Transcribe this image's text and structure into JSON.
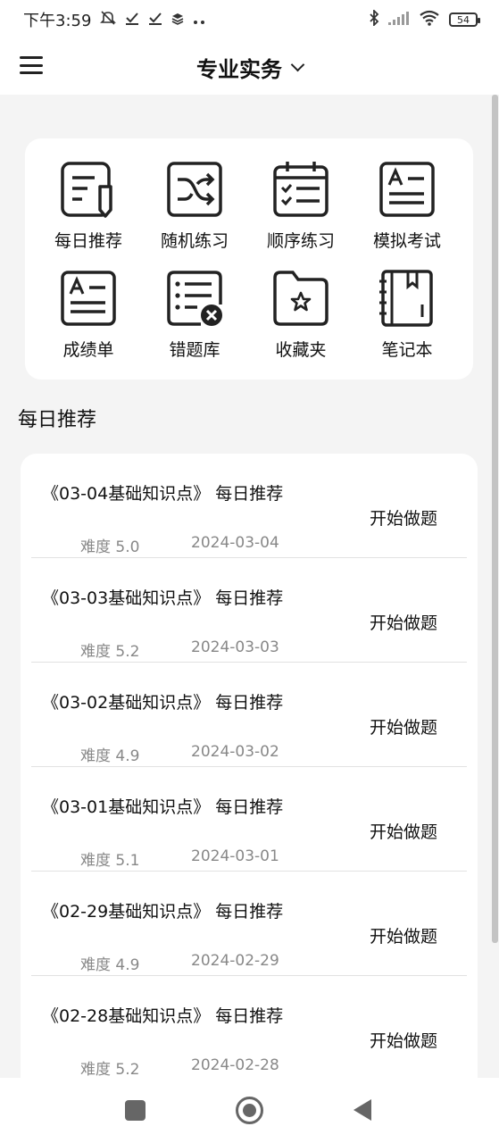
{
  "status_bar": {
    "time": "下午3:59",
    "battery": "54",
    "left_icons": [
      "mute-icon",
      "check-icon",
      "check-icon",
      "layers-icon",
      "more-dots-icon"
    ],
    "right_icons": [
      "bluetooth-icon",
      "signal-icon",
      "wifi-icon",
      "battery-icon"
    ]
  },
  "header": {
    "title": "专业实务"
  },
  "grid": {
    "items": [
      {
        "label": "每日推荐",
        "icon": "daily-recommend-icon"
      },
      {
        "label": "随机练习",
        "icon": "shuffle-icon"
      },
      {
        "label": "顺序练习",
        "icon": "calendar-list-icon"
      },
      {
        "label": "模拟考试",
        "icon": "exam-paper-icon"
      },
      {
        "label": "成绩单",
        "icon": "transcript-icon"
      },
      {
        "label": "错题库",
        "icon": "wrong-list-icon"
      },
      {
        "label": "收藏夹",
        "icon": "favorite-folder-icon"
      },
      {
        "label": "笔记本",
        "icon": "notebook-icon"
      }
    ]
  },
  "section": {
    "title": "每日推荐"
  },
  "list": {
    "rows": [
      {
        "title": "《03-04基础知识点》 每日推荐",
        "difficulty": "难度 5.0",
        "date": "2024-03-04",
        "action": "开始做题"
      },
      {
        "title": "《03-03基础知识点》 每日推荐",
        "difficulty": "难度 5.2",
        "date": "2024-03-03",
        "action": "开始做题"
      },
      {
        "title": "《03-02基础知识点》 每日推荐",
        "difficulty": "难度 4.9",
        "date": "2024-03-02",
        "action": "开始做题"
      },
      {
        "title": "《03-01基础知识点》 每日推荐",
        "difficulty": "难度 5.1",
        "date": "2024-03-01",
        "action": "开始做题"
      },
      {
        "title": "《02-29基础知识点》 每日推荐",
        "difficulty": "难度 4.9",
        "date": "2024-02-29",
        "action": "开始做题"
      },
      {
        "title": "《02-28基础知识点》 每日推荐",
        "difficulty": "难度 5.2",
        "date": "2024-02-28",
        "action": "开始做题"
      }
    ]
  },
  "nav": {
    "icons": [
      "recent-apps-icon",
      "home-icon",
      "back-icon"
    ]
  }
}
